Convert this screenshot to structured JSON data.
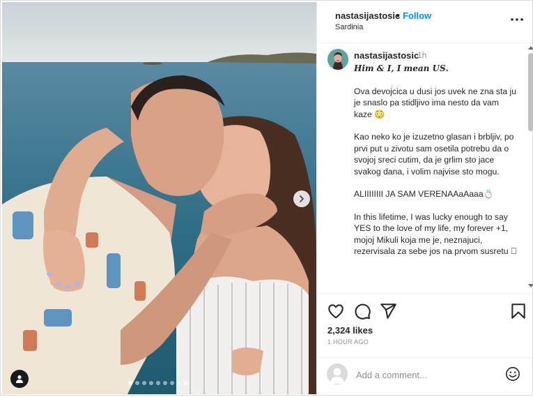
{
  "header": {
    "username": "nastasijastosic",
    "separator": "•",
    "follow_label": "Follow",
    "location": "Sardinia"
  },
  "post": {
    "author": "nastasijastosic",
    "time": "1h",
    "caption_lead": "𝑯𝒊𝒎 & 𝑰, 𝑰 𝒎𝒆𝒂𝒏 𝑼𝑺.",
    "paragraphs": [
      "Ova devojcica u dusi jos uvek ne zna sta ju je snaslo pa stidljivo ima nesto da vam kaze 😳",
      "Kao neko ko je izuzetno glasan i brbljiv, po prvi put u zivotu sam osetila potrebu da o svojoj sreci cutim, da je grlim sto jace svakog dana, i volim najvise sto mogu.",
      "ALIIIIIIII JA SAM VERENAAaAaaa💍",
      "In this lifetime, I was lucky enough to say YES to the love of my life, my forever +1, mojoj Mikuli koja me je, neznajuci, rezervisala za sebe jos na prvom susretu 🏻"
    ]
  },
  "engagement": {
    "likes": "2,324 likes",
    "posted_ago": "1 HOUR AGO"
  },
  "comment_box": {
    "placeholder": "Add a comment..."
  },
  "carousel": {
    "slide_count": 9,
    "active_index": 0
  },
  "colors": {
    "accent": "#0095f6",
    "muted": "#8e8e8e",
    "text": "#262626",
    "border": "#efefef"
  },
  "icons": [
    "more-options-icon",
    "heart-icon",
    "comment-icon",
    "share-icon",
    "bookmark-icon",
    "emoji-icon",
    "tag-people-icon",
    "next-arrow-icon"
  ]
}
